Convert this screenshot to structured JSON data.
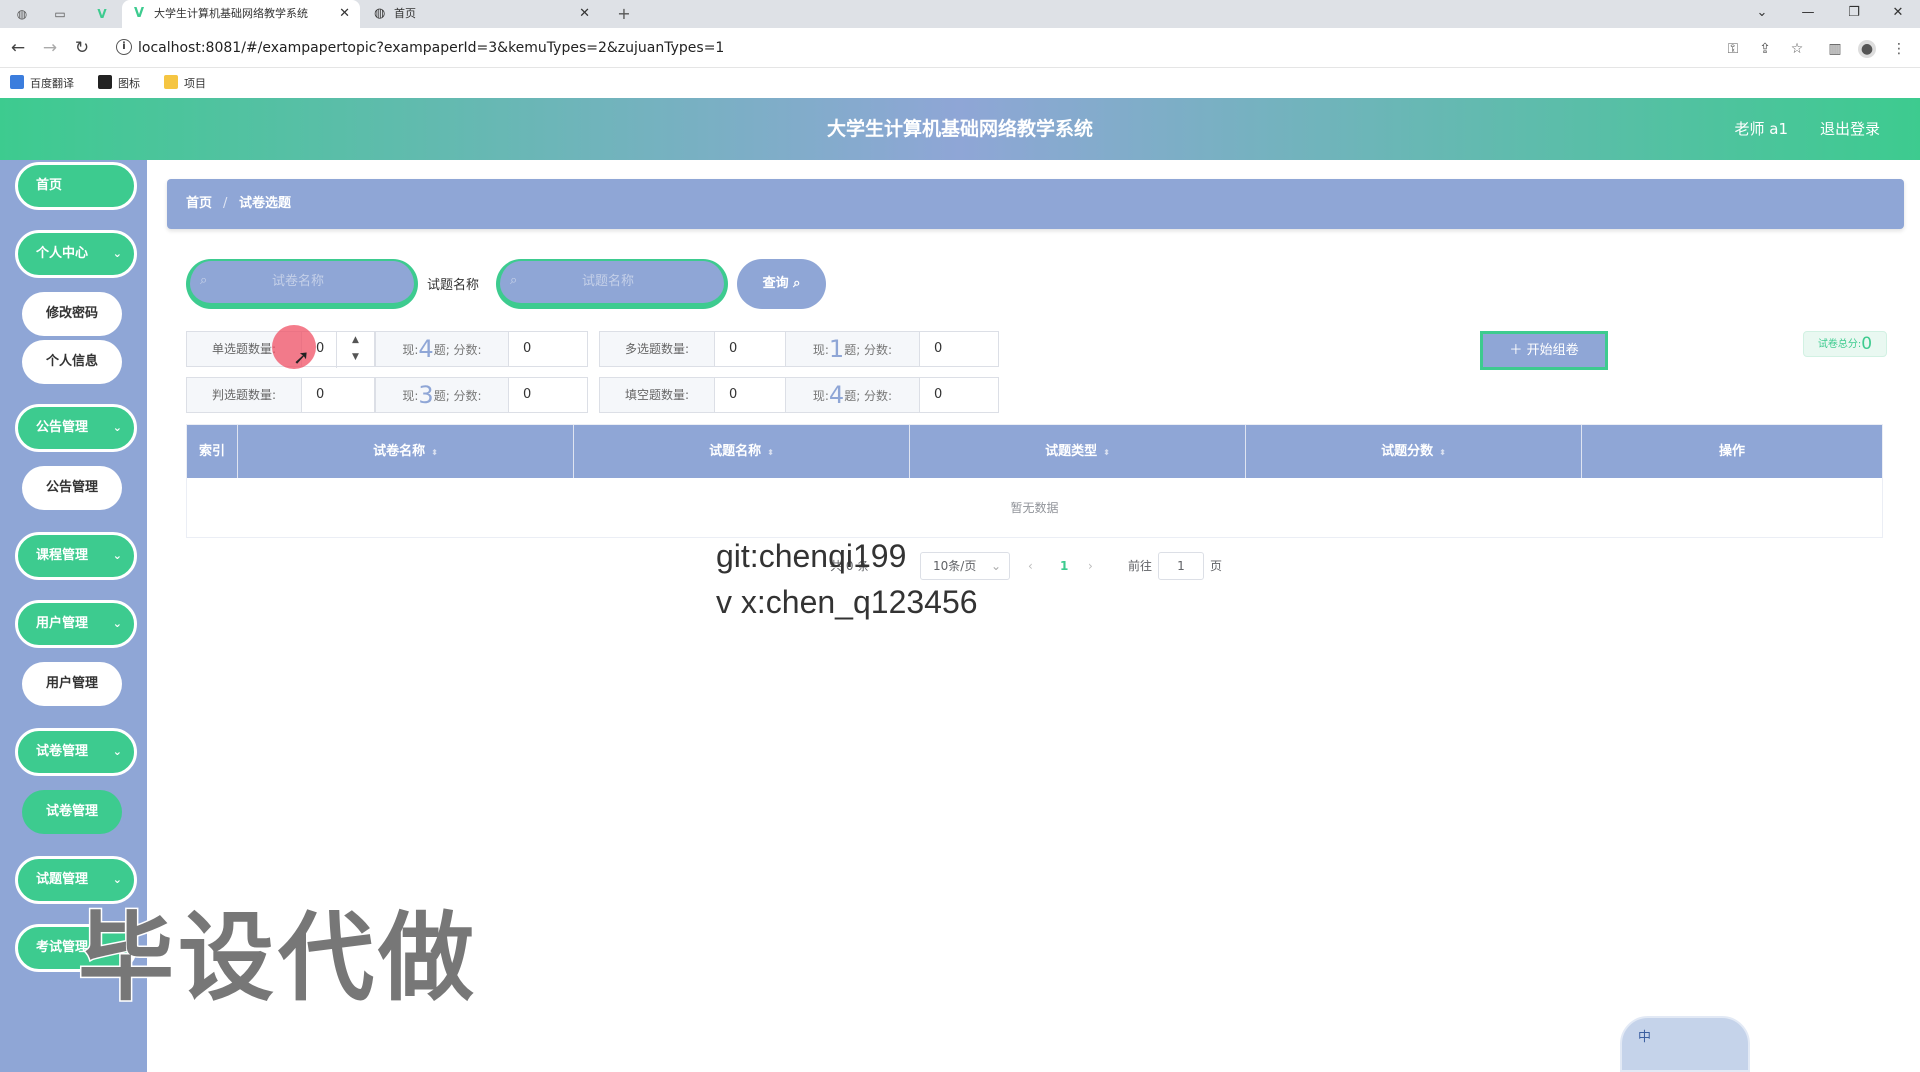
{
  "browser": {
    "tabs": [
      {
        "label": "大学生计算机基础网络教学系统",
        "active": true,
        "icon": "vue-logo-icon"
      },
      {
        "label": "首页",
        "active": false,
        "icon": "globe-icon"
      }
    ],
    "url": "localhost:8081/#/exampapertopic?exampaperId=3&kemuTypes=2&zujuanTypes=1",
    "bookmarks": [
      "百度翻译",
      "图标",
      "项目"
    ]
  },
  "header": {
    "title": "大学生计算机基础网络教学系统",
    "user": "老师 a1",
    "logout": "退出登录"
  },
  "sidebar": {
    "home": "首页",
    "personal_center": "个人中心",
    "change_password": "修改密码",
    "personal_info": "个人信息",
    "notice_mgmt": "公告管理",
    "notice_mgmt_sub": "公告管理",
    "course_mgmt": "课程管理",
    "user_mgmt": "用户管理",
    "user_mgmt_sub": "用户管理",
    "paper_mgmt": "试卷管理",
    "paper_mgmt_sub": "试卷管理",
    "question_mgmt": "试题管理",
    "exam_mgmt": "考试管理"
  },
  "breadcrumb": {
    "home": "首页",
    "sep": "/",
    "current": "试卷选题"
  },
  "search": {
    "paper_placeholder": "试卷名称",
    "question_label": "试题名称",
    "question_placeholder": "试题名称",
    "query_label": "查询"
  },
  "config": {
    "single": {
      "label": "单选题数量:",
      "value": "0",
      "cnt_pre": "现:",
      "count": "4",
      "cnt_post": "题; 分数:",
      "score": "0"
    },
    "multi": {
      "label": "多选题数量:",
      "value": "0",
      "cnt_pre": "现:",
      "count": "1",
      "cnt_post": "题; 分数:",
      "score": "0"
    },
    "judge": {
      "label": "判选题数量:",
      "value": "0",
      "cnt_pre": "现:",
      "count": "3",
      "cnt_post": "题; 分数:",
      "score": "0"
    },
    "fill": {
      "label": "填空题数量:",
      "value": "0",
      "cnt_pre": "现:",
      "count": "4",
      "cnt_post": "题; 分数:",
      "score": "0"
    }
  },
  "start_button": "开始组卷",
  "total": {
    "label": "试卷总分:",
    "value": "0"
  },
  "table": {
    "columns": [
      "索引",
      "试卷名称",
      "试题名称",
      "试题类型",
      "试题分数",
      "操作"
    ],
    "empty_text": "暂无数据"
  },
  "pagination": {
    "total_text": "共 0 条",
    "page_size": "10条/页",
    "current_page": "1",
    "goto_pre": "前往",
    "goto_value": "1",
    "goto_post": "页"
  },
  "watermarks": {
    "line1": "git:chenqi199",
    "line2": "v x:chen_q123456",
    "big": "毕设代做"
  },
  "ime": {
    "label": "中"
  },
  "colors": {
    "primary_green": "#3dcb8f",
    "primary_blue": "#8fa6d6"
  }
}
